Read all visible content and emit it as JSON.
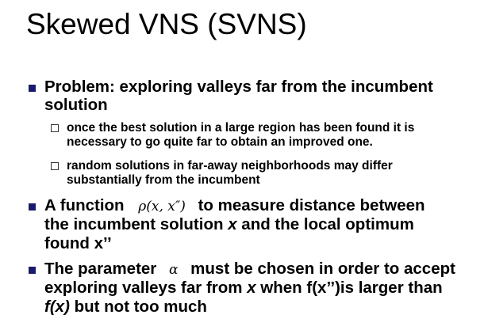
{
  "title": "Skewed VNS (SVNS)",
  "bullets": [
    {
      "line1": "Problem:  exploring valleys far from the incumbent",
      "line2": "solution",
      "sub": [
        {
          "line1": "once the best solution in a large region has been found it is",
          "line2": "necessary to go quite far to obtain an improved one."
        },
        {
          "line1": "random solutions in far-away neighborhoods may differ",
          "line2": "substantially from the incumbent"
        }
      ]
    },
    {
      "line1_a": "A function",
      "formula": "ρ(x, x″)",
      "line1_b": "to measure distance between",
      "line2_a": "the incumbent solution ",
      "line2_x": "x",
      "line2_b": " and the local optimum",
      "line3": "found x’’"
    },
    {
      "line1_a": "The parameter",
      "alpha": "α",
      "line1_b": "must be chosen in order to accept",
      "line2_a": "exploring valleys far from ",
      "line2_x": "x",
      "line2_b": " when f(x’’)is larger than",
      "line3_f": "f(",
      "line3_x": "x",
      "line3_close": ")",
      "line3_b": " but not too much"
    }
  ],
  "colors": {
    "bullet": "#1a1a6e",
    "subbox_border": "#333333"
  }
}
